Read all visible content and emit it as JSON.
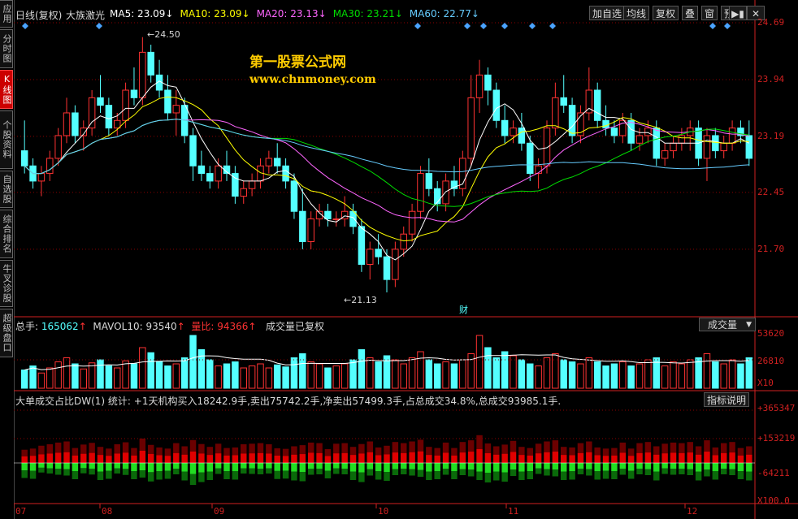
{
  "sidebar": {
    "tabs": [
      {
        "label": "应用",
        "active": false
      },
      {
        "label": "分时图",
        "active": false
      },
      {
        "label": "K线图",
        "active": true
      },
      {
        "label": "个股资料",
        "active": false
      },
      {
        "label": "自选股",
        "active": false
      },
      {
        "label": "综合排名",
        "active": false
      },
      {
        "label": "牛叉诊股",
        "active": false
      },
      {
        "label": "超级盘口",
        "active": false
      }
    ]
  },
  "price_panel": {
    "title": "日线(复权)",
    "indicator": "大族激光",
    "ma": [
      {
        "label": "MA5: 23.09",
        "color": "#ffffff"
      },
      {
        "label": "MA10: 23.09",
        "color": "#ffff00"
      },
      {
        "label": "MA20: 23.13",
        "color": "#ff66ff"
      },
      {
        "label": "MA30: 23.21",
        "color": "#00dd00"
      },
      {
        "label": "MA60: 22.77",
        "color": "#66ccff"
      }
    ],
    "toolbar": [
      "加自选",
      "均线",
      "复权",
      "叠",
      "窗",
      "预测"
    ],
    "y_labels": [
      "24.69",
      "23.94",
      "23.19",
      "22.45",
      "21.70"
    ],
    "high_marker": "24.50",
    "low_marker": "21.13",
    "event_marker": "财"
  },
  "watermark": {
    "title": "第一股票公式网",
    "url": "www.chnmoney.com"
  },
  "volume_panel": {
    "total_label": "总手:",
    "total_value": "165062",
    "mavol_label": "MAVOL10:",
    "mavol_value": "93540",
    "ratio_label": "量比:",
    "ratio_value": "94366",
    "note": "成交量已复权",
    "dropdown": "成交量",
    "y_labels": [
      "53620",
      "26810"
    ],
    "unit": "X10"
  },
  "dw_panel": {
    "stats": "大单成交占比DW(1) 统计: +1天机构买入18242.9手,卖出75742.2手,净卖出57499.3手,占总成交34.8%,总成交93985.1手.",
    "button": "指标说明",
    "y_labels": [
      "+365347",
      "+153219",
      "-64211"
    ],
    "unit": "X100.0"
  },
  "x_axis": {
    "labels": [
      "07",
      "08",
      "09",
      "10",
      "11",
      "12"
    ]
  },
  "colors": {
    "up": "#ff3232",
    "down": "#54ffff",
    "grid": "#8b0000",
    "axis": "#d02020"
  },
  "chart_data": {
    "type": "candlestick",
    "y_range": [
      21.13,
      24.69
    ],
    "candles": [
      [
        23.0,
        23.4,
        22.7,
        22.8
      ],
      [
        22.8,
        22.9,
        22.5,
        22.6
      ],
      [
        22.6,
        22.8,
        22.4,
        22.7
      ],
      [
        22.7,
        23.0,
        22.6,
        22.9
      ],
      [
        22.9,
        23.3,
        22.8,
        23.2
      ],
      [
        23.2,
        23.7,
        23.1,
        23.5
      ],
      [
        23.5,
        23.6,
        23.1,
        23.2
      ],
      [
        23.2,
        23.4,
        23.0,
        23.3
      ],
      [
        23.3,
        23.8,
        23.2,
        23.7
      ],
      [
        23.7,
        24.0,
        23.5,
        23.6
      ],
      [
        23.6,
        23.7,
        23.2,
        23.3
      ],
      [
        23.3,
        23.5,
        23.2,
        23.4
      ],
      [
        23.4,
        23.9,
        23.3,
        23.8
      ],
      [
        23.8,
        24.1,
        23.6,
        23.7
      ],
      [
        23.7,
        24.5,
        23.6,
        24.3
      ],
      [
        24.3,
        24.4,
        23.9,
        24.0
      ],
      [
        24.0,
        24.2,
        23.7,
        23.8
      ],
      [
        23.8,
        24.0,
        23.4,
        23.5
      ],
      [
        23.5,
        23.8,
        23.2,
        23.6
      ],
      [
        23.6,
        23.7,
        23.1,
        23.2
      ],
      [
        23.2,
        23.3,
        22.6,
        22.8
      ],
      [
        22.8,
        23.0,
        22.6,
        22.7
      ],
      [
        22.7,
        22.8,
        22.5,
        22.6
      ],
      [
        22.6,
        22.9,
        22.5,
        22.8
      ],
      [
        22.8,
        23.0,
        22.6,
        22.7
      ],
      [
        22.7,
        22.8,
        22.3,
        22.4
      ],
      [
        22.4,
        22.6,
        22.3,
        22.5
      ],
      [
        22.5,
        22.7,
        22.4,
        22.6
      ],
      [
        22.6,
        22.9,
        22.5,
        22.8
      ],
      [
        22.8,
        23.0,
        22.7,
        22.9
      ],
      [
        22.9,
        23.1,
        22.7,
        22.8
      ],
      [
        22.8,
        22.9,
        22.5,
        22.6
      ],
      [
        22.6,
        22.7,
        22.1,
        22.2
      ],
      [
        22.2,
        22.5,
        21.7,
        21.8
      ],
      [
        21.8,
        22.2,
        21.7,
        22.1
      ],
      [
        22.1,
        22.3,
        22.0,
        22.2
      ],
      [
        22.2,
        22.3,
        22.0,
        22.1
      ],
      [
        22.1,
        22.2,
        22.0,
        22.1
      ],
      [
        22.1,
        22.4,
        22.0,
        22.2
      ],
      [
        22.2,
        22.3,
        21.9,
        22.0
      ],
      [
        22.0,
        22.1,
        21.4,
        21.5
      ],
      [
        21.5,
        21.8,
        21.3,
        21.7
      ],
      [
        21.7,
        21.9,
        21.5,
        21.6
      ],
      [
        21.6,
        21.7,
        21.13,
        21.3
      ],
      [
        21.3,
        21.8,
        21.2,
        21.7
      ],
      [
        21.7,
        22.0,
        21.6,
        21.9
      ],
      [
        21.9,
        22.3,
        21.8,
        22.2
      ],
      [
        22.2,
        22.8,
        22.1,
        22.7
      ],
      [
        22.7,
        22.9,
        22.4,
        22.5
      ],
      [
        22.5,
        22.6,
        22.2,
        22.3
      ],
      [
        22.3,
        22.7,
        22.2,
        22.6
      ],
      [
        22.6,
        22.8,
        22.4,
        22.5
      ],
      [
        22.5,
        23.0,
        22.4,
        22.9
      ],
      [
        22.9,
        24.0,
        22.8,
        23.7
      ],
      [
        23.7,
        24.2,
        23.5,
        24.0
      ],
      [
        24.0,
        24.1,
        23.6,
        23.8
      ],
      [
        23.8,
        23.9,
        23.3,
        23.4
      ],
      [
        23.4,
        23.6,
        23.1,
        23.2
      ],
      [
        23.2,
        23.4,
        23.1,
        23.3
      ],
      [
        23.3,
        23.5,
        23.0,
        23.1
      ],
      [
        23.1,
        23.2,
        22.6,
        22.7
      ],
      [
        22.7,
        22.9,
        22.5,
        22.8
      ],
      [
        22.8,
        23.4,
        22.7,
        23.3
      ],
      [
        23.3,
        23.9,
        23.2,
        23.7
      ],
      [
        23.7,
        24.0,
        23.5,
        23.6
      ],
      [
        23.6,
        23.7,
        23.1,
        23.2
      ],
      [
        23.2,
        23.6,
        23.1,
        23.5
      ],
      [
        23.5,
        24.1,
        23.4,
        23.8
      ],
      [
        23.8,
        23.9,
        23.3,
        23.4
      ],
      [
        23.4,
        23.6,
        23.2,
        23.3
      ],
      [
        23.3,
        23.4,
        23.1,
        23.2
      ],
      [
        23.2,
        23.5,
        23.1,
        23.4
      ],
      [
        23.4,
        23.5,
        23.0,
        23.1
      ],
      [
        23.1,
        23.3,
        23.0,
        23.2
      ],
      [
        23.2,
        23.4,
        23.1,
        23.3
      ],
      [
        23.3,
        23.4,
        22.8,
        22.9
      ],
      [
        22.9,
        23.1,
        22.8,
        23.0
      ],
      [
        23.0,
        23.2,
        22.9,
        23.1
      ],
      [
        23.1,
        23.3,
        23.0,
        23.2
      ],
      [
        23.2,
        23.4,
        23.0,
        23.3
      ],
      [
        23.3,
        23.4,
        22.8,
        22.9
      ],
      [
        22.9,
        23.3,
        22.6,
        23.2
      ],
      [
        23.2,
        23.3,
        22.9,
        23.0
      ],
      [
        23.0,
        23.2,
        22.9,
        23.1
      ],
      [
        23.1,
        23.4,
        23.0,
        23.3
      ],
      [
        23.3,
        23.4,
        23.1,
        23.2
      ],
      [
        23.2,
        23.4,
        22.8,
        22.9
      ]
    ],
    "volume": [
      18,
      22,
      15,
      20,
      26,
      30,
      24,
      19,
      25,
      28,
      22,
      20,
      27,
      24,
      40,
      35,
      26,
      22,
      24,
      30,
      52,
      38,
      28,
      22,
      24,
      26,
      20,
      22,
      24,
      20,
      23,
      21,
      30,
      34,
      26,
      24,
      20,
      22,
      24,
      28,
      38,
      30,
      26,
      32,
      28,
      24,
      30,
      36,
      28,
      24,
      26,
      24,
      28,
      34,
      52,
      40,
      30,
      36,
      32,
      28,
      24,
      22,
      30,
      34,
      28,
      26,
      24,
      30,
      26,
      22,
      24,
      26,
      22,
      24,
      28,
      30,
      22,
      26,
      24,
      28,
      30,
      34,
      26,
      24,
      28,
      24,
      30
    ]
  }
}
